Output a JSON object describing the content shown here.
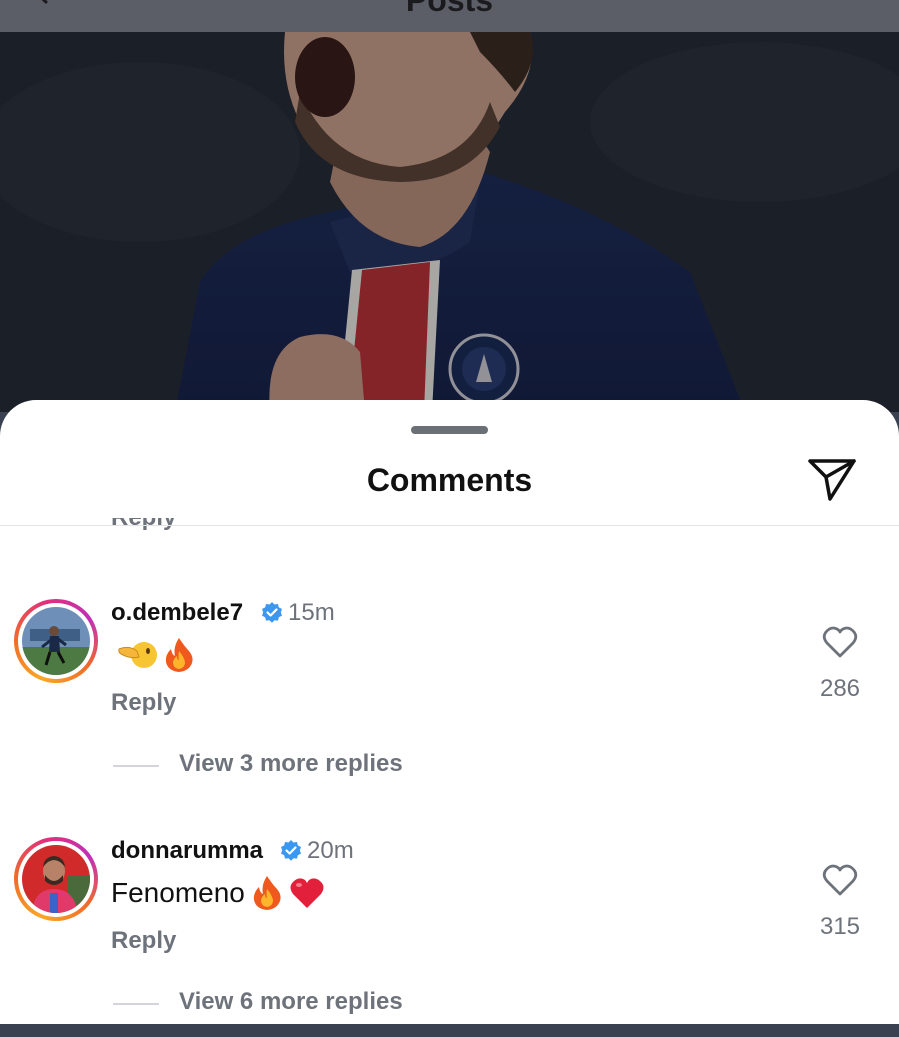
{
  "top_bar": {
    "title": "Posts"
  },
  "sheet": {
    "title": "Comments",
    "cut_off_reply": "Reply"
  },
  "colors": {
    "accent_verified": "#3b97f0",
    "muted": "#6e737b",
    "heart_red": "#e3203b"
  },
  "comments": [
    {
      "username": "o.dembele7",
      "verified": true,
      "time": "15m",
      "text": "",
      "emojis": [
        "pointing-hand-face-emoji",
        "fire-emoji"
      ],
      "reply_label": "Reply",
      "likes": "286",
      "view_more": "View 3 more replies"
    },
    {
      "username": "donnarumma",
      "verified": true,
      "time": "20m",
      "text": "Fenomeno",
      "emojis": [
        "fire-emoji",
        "red-heart-emoji"
      ],
      "reply_label": "Reply",
      "likes": "315",
      "view_more": "View 6 more replies"
    }
  ]
}
